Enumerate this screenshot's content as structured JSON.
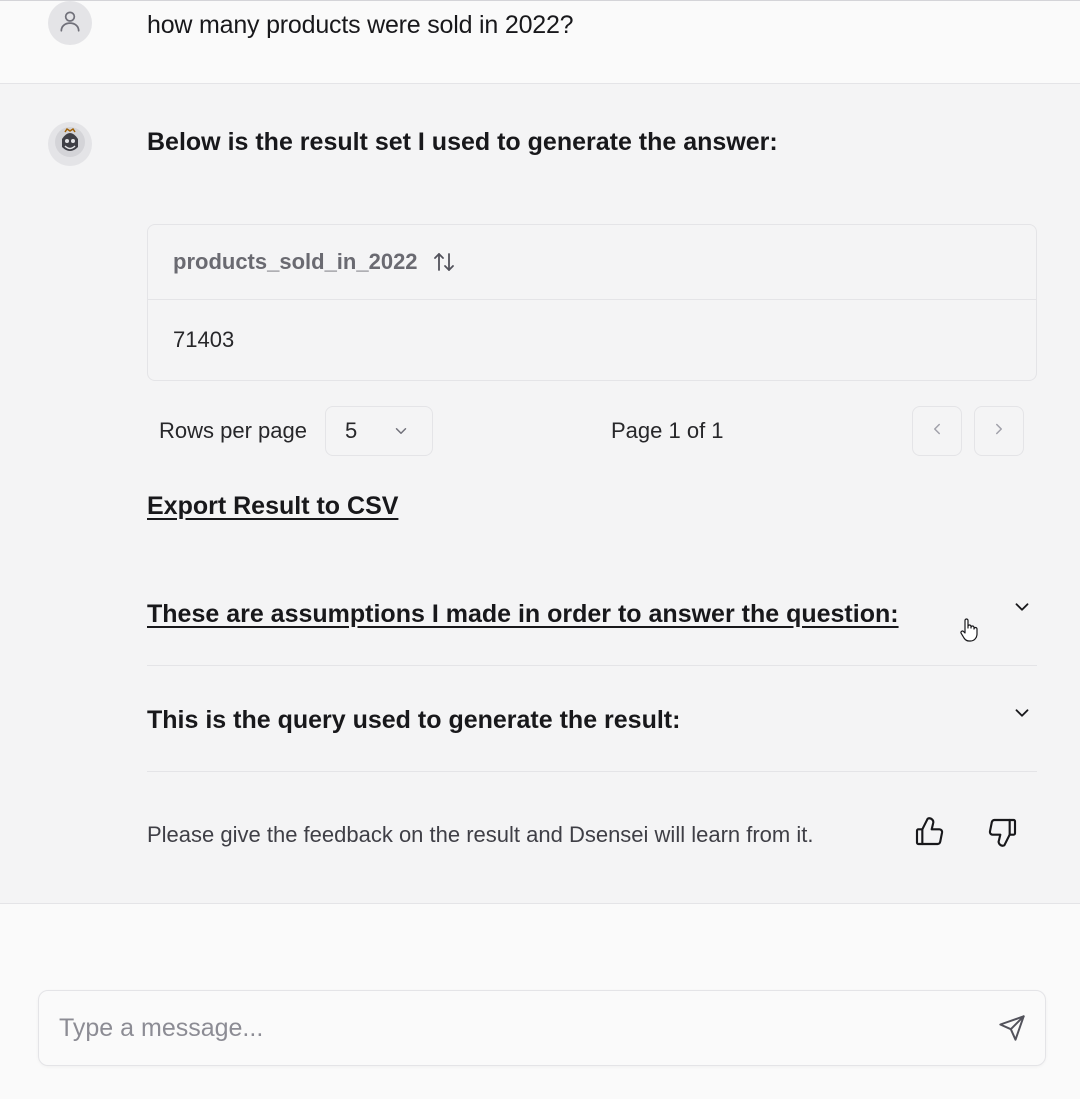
{
  "user_message": {
    "text": "how many products were sold in 2022?",
    "avatar_icon": "user-icon"
  },
  "assistant_message": {
    "avatar_icon": "bot-avatar-icon",
    "heading": "Below is the result set I used to generate the answer:",
    "table": {
      "columns": [
        "products_sold_in_2022"
      ],
      "rows": [
        [
          "71403"
        ]
      ],
      "sort_icon": "sort-arrows-icon"
    },
    "pagination": {
      "rows_label": "Rows per page",
      "rows_value": "5",
      "page_label": "Page 1 of 1"
    },
    "export_label": "Export Result to CSV",
    "accordions": [
      {
        "title": "These are assumptions I made in order to answer the question:"
      },
      {
        "title": "This is the query used to generate the result:"
      }
    ],
    "feedback": {
      "text": "Please give the feedback on the result and Dsensei will learn from it."
    }
  },
  "composer": {
    "placeholder": "Type a message...",
    "send_icon": "send-icon"
  },
  "colors": {
    "user_bg": "#fafafa",
    "assistant_bg": "#f4f4f5",
    "border": "#e4e4e7",
    "text": "#18181b"
  }
}
